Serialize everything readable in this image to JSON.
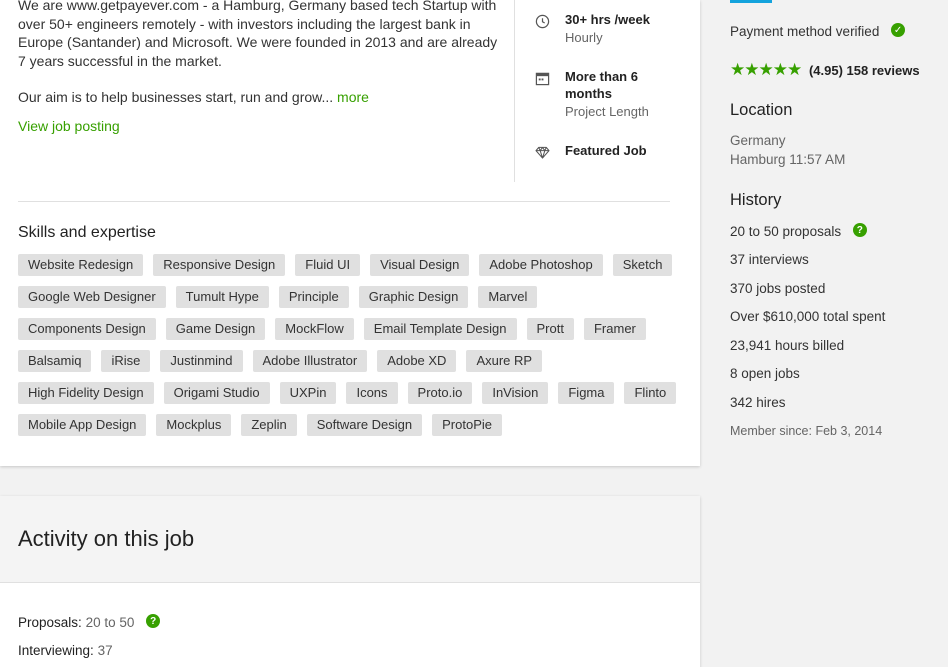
{
  "description": {
    "paragraph1": "We are www.getpayever.com - a Hamburg, Germany based tech Startup with over 50+ engineers remotely - with investors including the largest bank in Europe (Santander) and Microsoft. We were founded in 2013 and are already 7 years successful in the market.",
    "paragraph2": "Our aim is to help businesses start, run and grow... ",
    "more_label": "more",
    "view_posting_label": "View job posting"
  },
  "job_meta": [
    {
      "icon": "clock-icon",
      "title": "30+ hrs /week",
      "subtitle": "Hourly"
    },
    {
      "icon": "calendar-icon",
      "title": "More than 6 months",
      "subtitle": "Project Length"
    },
    {
      "icon": "diamond-icon",
      "title": "Featured Job",
      "subtitle": ""
    }
  ],
  "skills": {
    "title": "Skills and expertise",
    "items": [
      "Website Redesign",
      "Responsive Design",
      "Fluid UI",
      "Visual Design",
      "Adobe Photoshop",
      "Sketch",
      "Google Web Designer",
      "Tumult Hype",
      "Principle",
      "Graphic Design",
      "Marvel",
      "Components Design",
      "Game Design",
      "MockFlow",
      "Email Template Design",
      "Prott",
      "Framer",
      "Balsamiq",
      "iRise",
      "Justinmind",
      "Adobe Illustrator",
      "Adobe XD",
      "Axure RP",
      "High Fidelity Design",
      "Origami Studio",
      "UXPin",
      "Icons",
      "Proto.io",
      "InVision",
      "Figma",
      "Flinto",
      "Mobile App Design",
      "Mockplus",
      "Zeplin",
      "Software Design",
      "ProtoPie"
    ]
  },
  "activity": {
    "title": "Activity on this job",
    "proposals_label": "Proposals:",
    "proposals_value": "20 to 50",
    "interviewing_label": "Interviewing:",
    "interviewing_value": "37"
  },
  "client": {
    "payment_verified": "Payment method verified",
    "rating_stars": 5,
    "rating_text": "(4.95) 158 reviews",
    "location_heading": "Location",
    "country": "Germany",
    "city_time": "Hamburg 11:57 AM",
    "history_heading": "History",
    "history": [
      "20 to 50 proposals",
      "37 interviews",
      "370 jobs posted",
      "Over $610,000 total spent",
      "23,941 hours billed",
      "8 open jobs",
      "342 hires"
    ],
    "member_since": "Member since: Feb 3, 2014"
  },
  "colors": {
    "accent_green": "#37a000",
    "top_accent_blue": "#14a3dd"
  }
}
